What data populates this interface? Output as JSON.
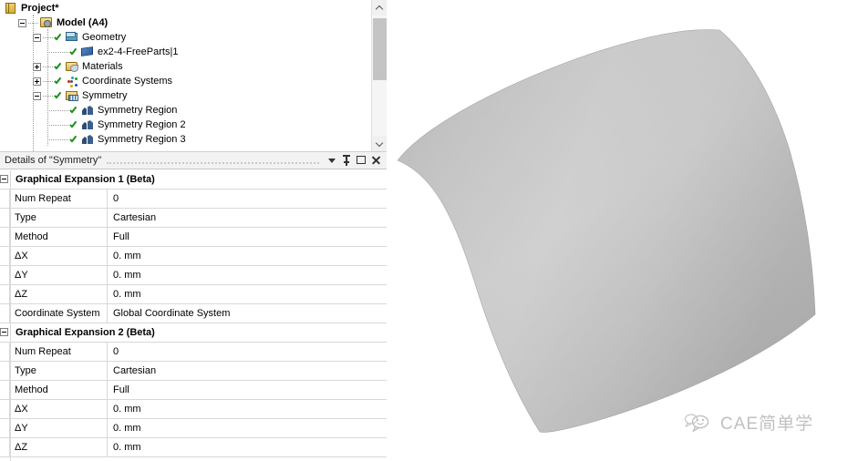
{
  "tree": {
    "scroll_up_icon": "chevron-up-icon",
    "scroll_down_icon": "chevron-down-icon",
    "items": [
      {
        "label": "Project*",
        "icon": "project-icon",
        "expander": "none",
        "check": false,
        "depth": 0,
        "bold": true
      },
      {
        "label": "Model (A4)",
        "icon": "model-icon",
        "expander": "minus",
        "check": false,
        "depth": 1,
        "bold": true
      },
      {
        "label": "Geometry",
        "icon": "geometry-icon",
        "expander": "minus",
        "check": true,
        "depth": 2,
        "bold": false
      },
      {
        "label": "ex2-4-FreeParts|1",
        "icon": "part-icon",
        "expander": "none",
        "check": true,
        "depth": 3,
        "bold": false
      },
      {
        "label": "Materials",
        "icon": "materials-icon",
        "expander": "plus",
        "check": true,
        "depth": 2,
        "bold": false
      },
      {
        "label": "Coordinate Systems",
        "icon": "coordinate-icon",
        "expander": "plus",
        "check": true,
        "depth": 2,
        "bold": false
      },
      {
        "label": "Symmetry",
        "icon": "symmetry-icon",
        "expander": "minus",
        "check": true,
        "depth": 2,
        "bold": false
      },
      {
        "label": "Symmetry Region",
        "icon": "symmetry-region-icon",
        "expander": "none",
        "check": true,
        "depth": 3,
        "bold": false
      },
      {
        "label": "Symmetry Region 2",
        "icon": "symmetry-region-icon",
        "expander": "none",
        "check": true,
        "depth": 3,
        "bold": false
      },
      {
        "label": "Symmetry Region 3",
        "icon": "symmetry-region-icon",
        "expander": "none",
        "check": true,
        "depth": 3,
        "bold": false
      }
    ]
  },
  "details": {
    "title": "Details of \"Symmetry\"",
    "header_buttons": [
      {
        "name": "dropdown-caret-icon",
        "glyph": "caret"
      },
      {
        "name": "pin-icon",
        "glyph": "pin"
      },
      {
        "name": "maximize-icon",
        "glyph": "square"
      },
      {
        "name": "close-icon",
        "glyph": "x"
      }
    ],
    "rows": [
      {
        "kind": "section",
        "label": "Graphical Expansion 1 (Beta)"
      },
      {
        "kind": "prop",
        "label": "Num Repeat",
        "value": "0"
      },
      {
        "kind": "prop",
        "label": "Type",
        "value": "Cartesian"
      },
      {
        "kind": "prop",
        "label": "Method",
        "value": "Full"
      },
      {
        "kind": "prop",
        "label": "ΔX",
        "value": "0. mm"
      },
      {
        "kind": "prop",
        "label": "ΔY",
        "value": "0. mm"
      },
      {
        "kind": "prop",
        "label": "ΔZ",
        "value": "0. mm"
      },
      {
        "kind": "prop",
        "label": "Coordinate System",
        "value": "Global Coordinate System"
      },
      {
        "kind": "section",
        "label": "Graphical Expansion 2 (Beta)"
      },
      {
        "kind": "prop",
        "label": "Num Repeat",
        "value": "0"
      },
      {
        "kind": "prop",
        "label": "Type",
        "value": "Cartesian"
      },
      {
        "kind": "prop",
        "label": "Method",
        "value": "Full"
      },
      {
        "kind": "prop",
        "label": "ΔX",
        "value": "0. mm"
      },
      {
        "kind": "prop",
        "label": "ΔY",
        "value": "0. mm"
      },
      {
        "kind": "prop",
        "label": "ΔZ",
        "value": "0. mm"
      }
    ]
  },
  "viewport": {
    "name": "3d-geometry-viewport",
    "background": "#ffffff",
    "surface_light": "#d0d0d0",
    "surface_mid": "#bfbfbf",
    "surface_dark": "#a8a8a8"
  },
  "watermark": {
    "text": "CAE简单学",
    "icon": "chat-bubble-smiley-icon",
    "color": "#8d8d8d"
  }
}
